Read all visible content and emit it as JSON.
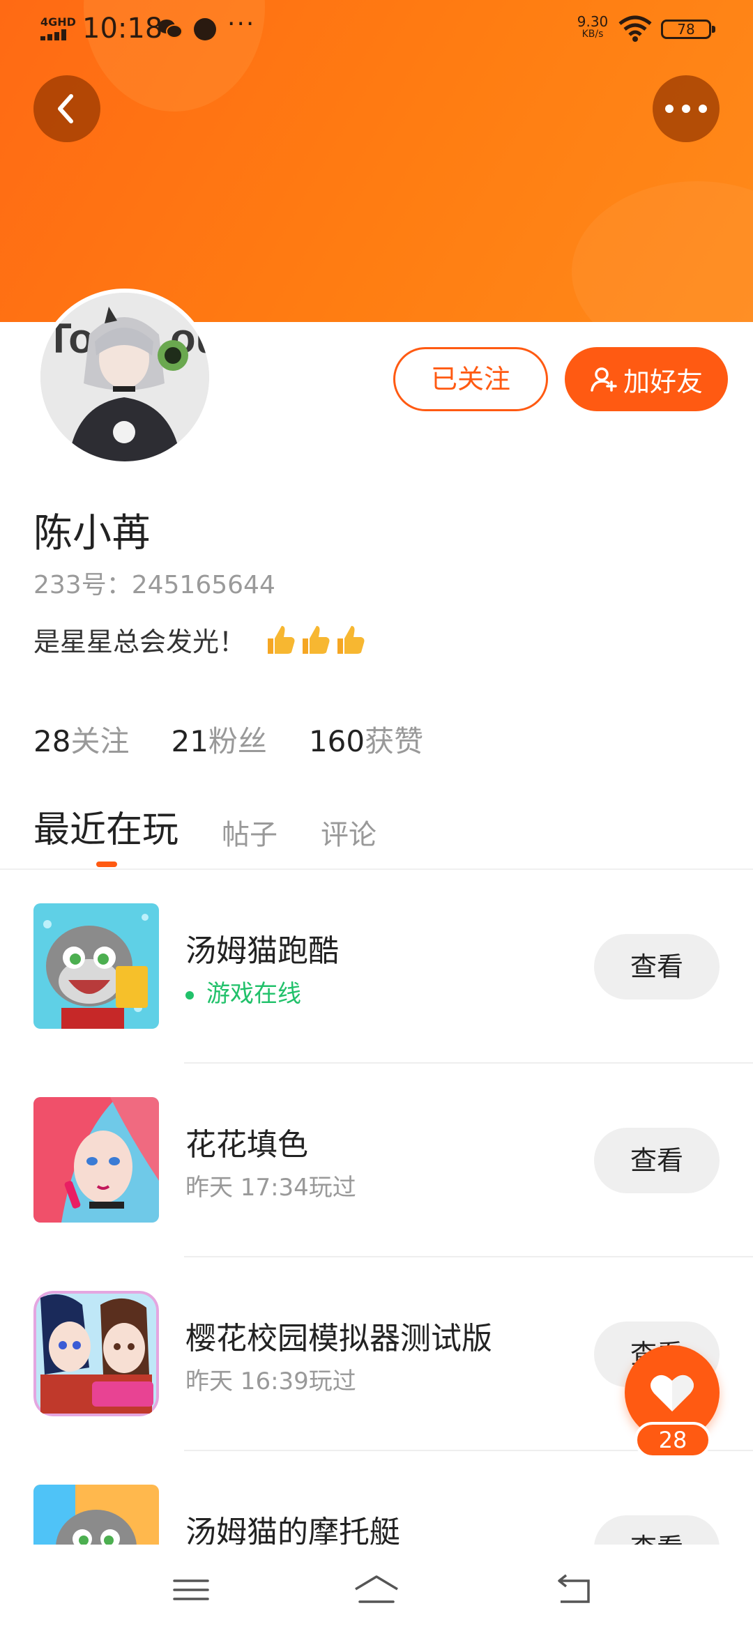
{
  "status_bar": {
    "network": "4GHD",
    "time": "10:18",
    "speed_value": "9.30",
    "speed_unit": "KB/s",
    "battery": "78",
    "more_dots": "···"
  },
  "header": {
    "back_icon": "chevron-left-icon",
    "more_icon": "more-dots-icon"
  },
  "profile": {
    "name": "陈小苒",
    "uid": "233号：245165644",
    "bio": "是星星总会发光！",
    "followed_label": "已关注",
    "add_friend_label": "加好友"
  },
  "stats": [
    {
      "num": "28",
      "label": "关注"
    },
    {
      "num": "21",
      "label": "粉丝"
    },
    {
      "num": "160",
      "label": "获赞"
    }
  ],
  "tabs": [
    {
      "label": "最近在玩",
      "active": true
    },
    {
      "label": "帖子",
      "active": false
    },
    {
      "label": "评论",
      "active": false
    }
  ],
  "games": [
    {
      "title": "汤姆猫跑酷",
      "subtitle": "游戏在线",
      "online": true,
      "button": "查看"
    },
    {
      "title": "花花填色",
      "subtitle": "昨天 17:34玩过",
      "online": false,
      "button": "查看"
    },
    {
      "title": "樱花校园模拟器测试版",
      "subtitle": "昨天 16:39玩过",
      "online": false,
      "button": "查看"
    },
    {
      "title": "汤姆猫的摩托艇",
      "subtitle": "",
      "online": false,
      "button": "查看"
    }
  ],
  "fab": {
    "count": "28"
  },
  "colors": {
    "accent": "#ff5a12",
    "online": "#21c16a",
    "header": "#ff7d12"
  }
}
